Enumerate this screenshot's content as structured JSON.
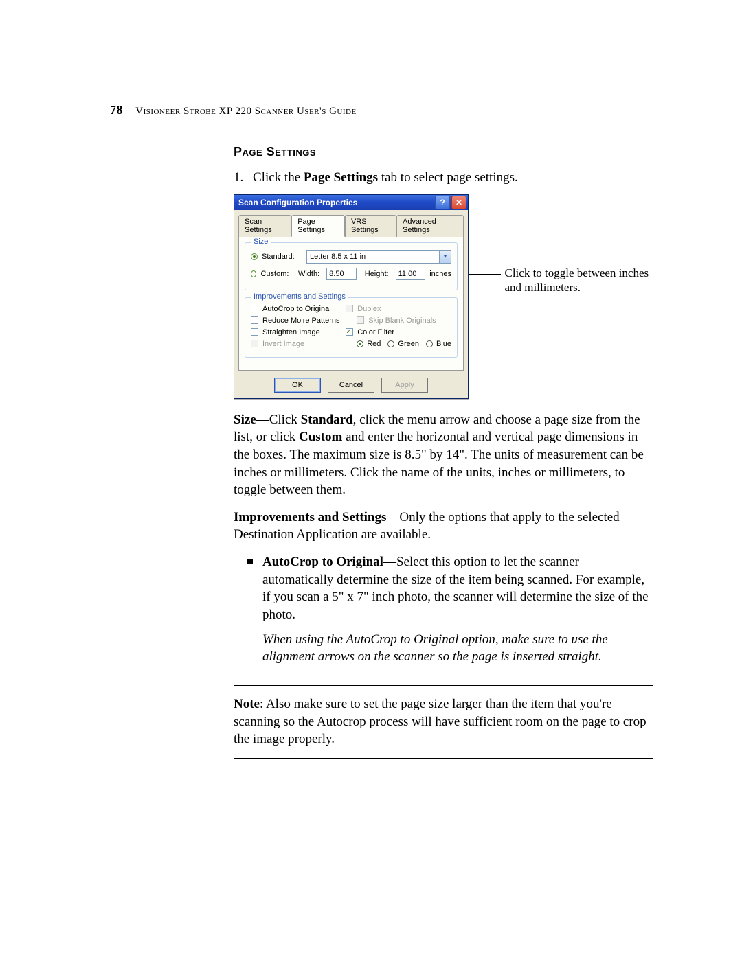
{
  "header": {
    "page_number": "78",
    "running_title": "Visioneer Strobe XP 220 Scanner User's Guide"
  },
  "section_title": "Page Settings",
  "step1_pre": "Click the ",
  "step1_bold": "Page Settings",
  "step1_post": " tab to select page settings.",
  "dialog": {
    "title": "Scan Configuration Properties",
    "tabs": {
      "scan": "Scan Settings",
      "page": "Page Settings",
      "vrs": "VRS Settings",
      "adv": "Advanced Settings"
    },
    "size": {
      "legend": "Size",
      "standard_label": "Standard:",
      "standard_value": "Letter 8.5 x 11 in",
      "custom_label": "Custom:",
      "width_label": "Width:",
      "width_value": "8.50",
      "height_label": "Height:",
      "height_value": "11.00",
      "units": "inches"
    },
    "improvements": {
      "legend": "Improvements and Settings",
      "autocrop": "AutoCrop to Original",
      "moire": "Reduce Moire Patterns",
      "straighten": "Straighten Image",
      "invert": "Invert Image",
      "duplex": "Duplex",
      "skip_blank": "Skip Blank Originals",
      "color_filter": "Color Filter",
      "red": "Red",
      "green": "Green",
      "blue": "Blue"
    },
    "buttons": {
      "ok": "OK",
      "cancel": "Cancel",
      "apply": "Apply"
    }
  },
  "callout": "Click to toggle between inches and millimeters.",
  "p_size": {
    "lead": "Size",
    "dash1": "—Click ",
    "standard": "Standard",
    "mid1": ", click the menu arrow and choose a page size from the list, or click ",
    "custom": "Custom",
    "mid2": " and enter the horizontal and vertical page dimensions in the boxes. The maximum size is 8.5\" by 14\". The units of measurement can be inches or millimeters. Click the name of the units, inches or millimeters, to toggle between them."
  },
  "p_imp": {
    "lead": "Improvements and Settings",
    "body": "—Only the options that apply to the selected Destination Application are available."
  },
  "bullet": {
    "lead": "AutoCrop to Original",
    "body": "—Select this option to let the scanner automatically determine the size of the item being scanned. For example, if you scan a 5\" x 7\" inch photo, the scanner will determine the size of the photo.",
    "note_italic": "When using the AutoCrop to Original option, make sure to use the alignment arrows on the scanner so the page is inserted straight."
  },
  "note": {
    "lead": "Note",
    "body": ": Also make sure to set the page size larger than the item that you're scanning so the Autocrop process will have sufficient room on the page to crop the image properly."
  }
}
